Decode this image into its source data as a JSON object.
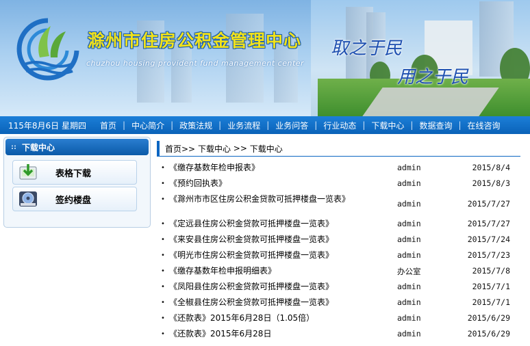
{
  "banner": {
    "title": "滁州市住房公积金管理中心",
    "subtitle": "chuzhou housing provident fund management center",
    "slogan_1": "取之于民",
    "slogan_2": "用之于民"
  },
  "nav": {
    "date_text": "115年8月6日 星期四",
    "items": [
      "首页",
      "中心简介",
      "政策法规",
      "业务流程",
      "业务问答",
      "行业动态",
      "下载中心",
      "数据查询",
      "在线咨询"
    ]
  },
  "sidebar": {
    "header": "下载中心",
    "items": [
      {
        "label": "表格下载",
        "icon": "download-icon"
      },
      {
        "label": "签约楼盘",
        "icon": "disc-icon"
      }
    ]
  },
  "breadcrumb": {
    "home": "首页>>",
    "section": "下载中心",
    "sep": ">>",
    "current": "下载中心"
  },
  "downloads": [
    {
      "title": "《缴存基数年检申报表》",
      "author": "admin",
      "date": "2015/8/4"
    },
    {
      "title": "《预约回执表》",
      "author": "admin",
      "date": "2015/8/3"
    },
    {
      "title": "《滁州市市区住房公积金贷款可抵押楼盘一览表》",
      "author": "admin",
      "date": "2015/7/27"
    },
    {
      "title": "《定远县住房公积金贷款可抵押楼盘一览表》",
      "author": "admin",
      "date": "2015/7/27"
    },
    {
      "title": "《来安县住房公积金贷款可抵押楼盘一览表》",
      "author": "admin",
      "date": "2015/7/24"
    },
    {
      "title": "《明光市住房公积金贷款可抵押楼盘一览表》",
      "author": "admin",
      "date": "2015/7/23"
    },
    {
      "title": "《缴存基数年检申报明细表》",
      "author": "办公室",
      "date": "2015/7/8"
    },
    {
      "title": "《凤阳县住房公积金贷款可抵押楼盘一览表》",
      "author": "admin",
      "date": "2015/7/1"
    },
    {
      "title": "《全椒县住房公积金贷款可抵押楼盘一览表》",
      "author": "admin",
      "date": "2015/7/1"
    },
    {
      "title": "《还款表》2015年6月28日（1.05倍）",
      "author": "admin",
      "date": "2015/6/29"
    },
    {
      "title": "《还款表》2015年6月28日",
      "author": "admin",
      "date": "2015/6/29"
    }
  ],
  "colors": {
    "nav_blue": "#0b66c2",
    "title_yellow": "#f2e21a",
    "slogan_blue": "#1d4fb0"
  }
}
